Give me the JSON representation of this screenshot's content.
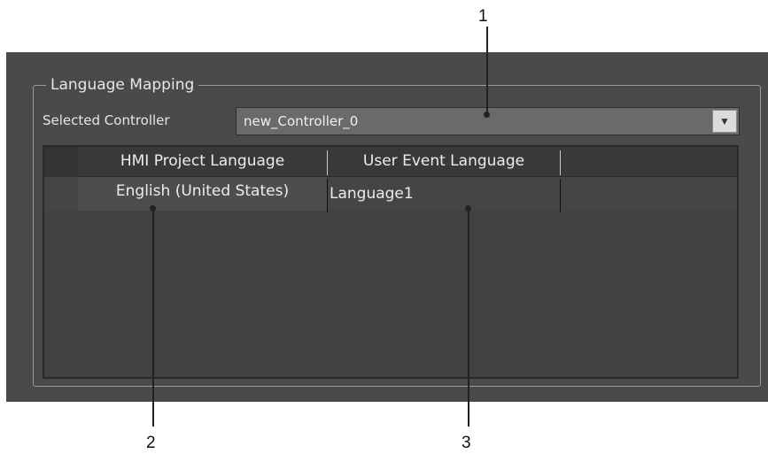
{
  "group": {
    "title": "Language Mapping"
  },
  "controller": {
    "label": "Selected Controller",
    "value": "new_Controller_0",
    "dropdown_icon": "triangle-down-icon"
  },
  "table": {
    "headers": [
      "HMI Project Language",
      "User Event Language",
      ""
    ],
    "rows": [
      [
        "English (United States)",
        "Language1",
        ""
      ]
    ]
  },
  "callouts": [
    "1",
    "2",
    "3"
  ]
}
